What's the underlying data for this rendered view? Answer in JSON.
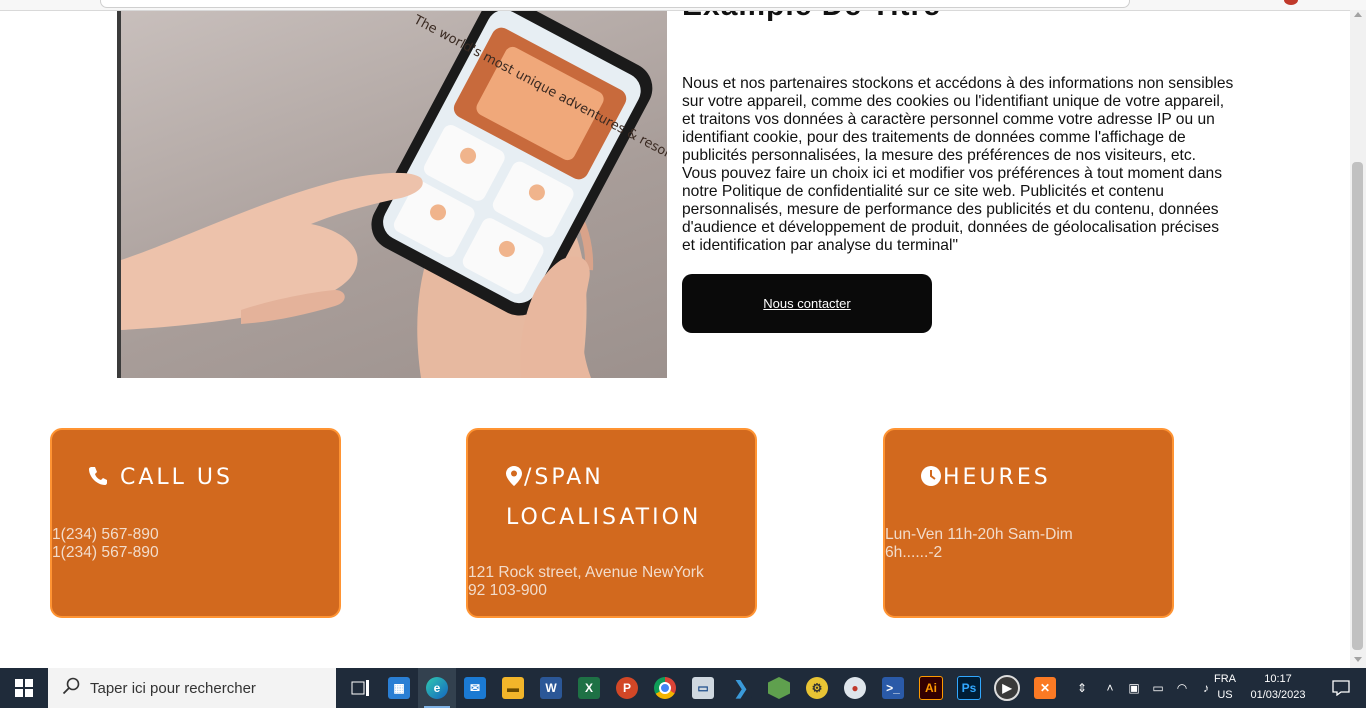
{
  "hero": {
    "title": "Example De Titre",
    "image_alt": "Main tenant un smartphone",
    "phone_screen_text": "The world's most unique adventures & resorts",
    "paragraph": "Nous et nos partenaires stockons et accédons à des informations non sensibles sur votre appareil, comme des cookies ou l'identifiant unique de votre appareil, et traitons vos données à caractère personnel comme votre adresse IP ou un identifiant cookie, pour des traitements de données comme l'affichage de publicités personnalisées, la mesure des préférences de nos visiteurs, etc. Vous pouvez faire un choix ici et modifier vos préférences à tout moment dans notre Politique de confidentialité sur ce site web. Publicités et contenu personnalisés, mesure de performance des publicités et du contenu, données d'audience et développement de produit, données de géolocalisation précises et identification par analyse du terminal\"",
    "cta_label": "Nous contacter"
  },
  "cards": [
    {
      "icon": "phone-icon",
      "title": "Call us",
      "lines": [
        "1(234) 567-890",
        "1(234) 567-890"
      ]
    },
    {
      "icon": "location-pin-icon",
      "title": "/span Localisation",
      "lines": [
        "121 Rock street, Avenue NewYork",
        "92 103-900"
      ]
    },
    {
      "icon": "clock-icon",
      "title": "Heures",
      "lines": [
        "Lun-Ven 11h-20h Sam-Dim",
        "6h......-2"
      ]
    }
  ],
  "colors": {
    "card_bg": "#d2691e",
    "card_border": "#ff9433",
    "cta_bg": "#0a0a0a",
    "taskbar_bg": "#1f2b3a"
  },
  "taskbar": {
    "search_placeholder": "Taper ici pour rechercher",
    "apps": [
      "task-view",
      "microsoft-store",
      "edge",
      "mail",
      "file-explorer",
      "word",
      "excel",
      "powerpoint",
      "chrome",
      "remote-desktop",
      "vs-code",
      "node",
      "app-cyclist",
      "paint",
      "powershell",
      "illustrator",
      "photoshop",
      "media-player",
      "xampp"
    ],
    "lang_primary": "FRA",
    "lang_secondary": "US",
    "time": "10:17",
    "date": "01/03/2023"
  }
}
